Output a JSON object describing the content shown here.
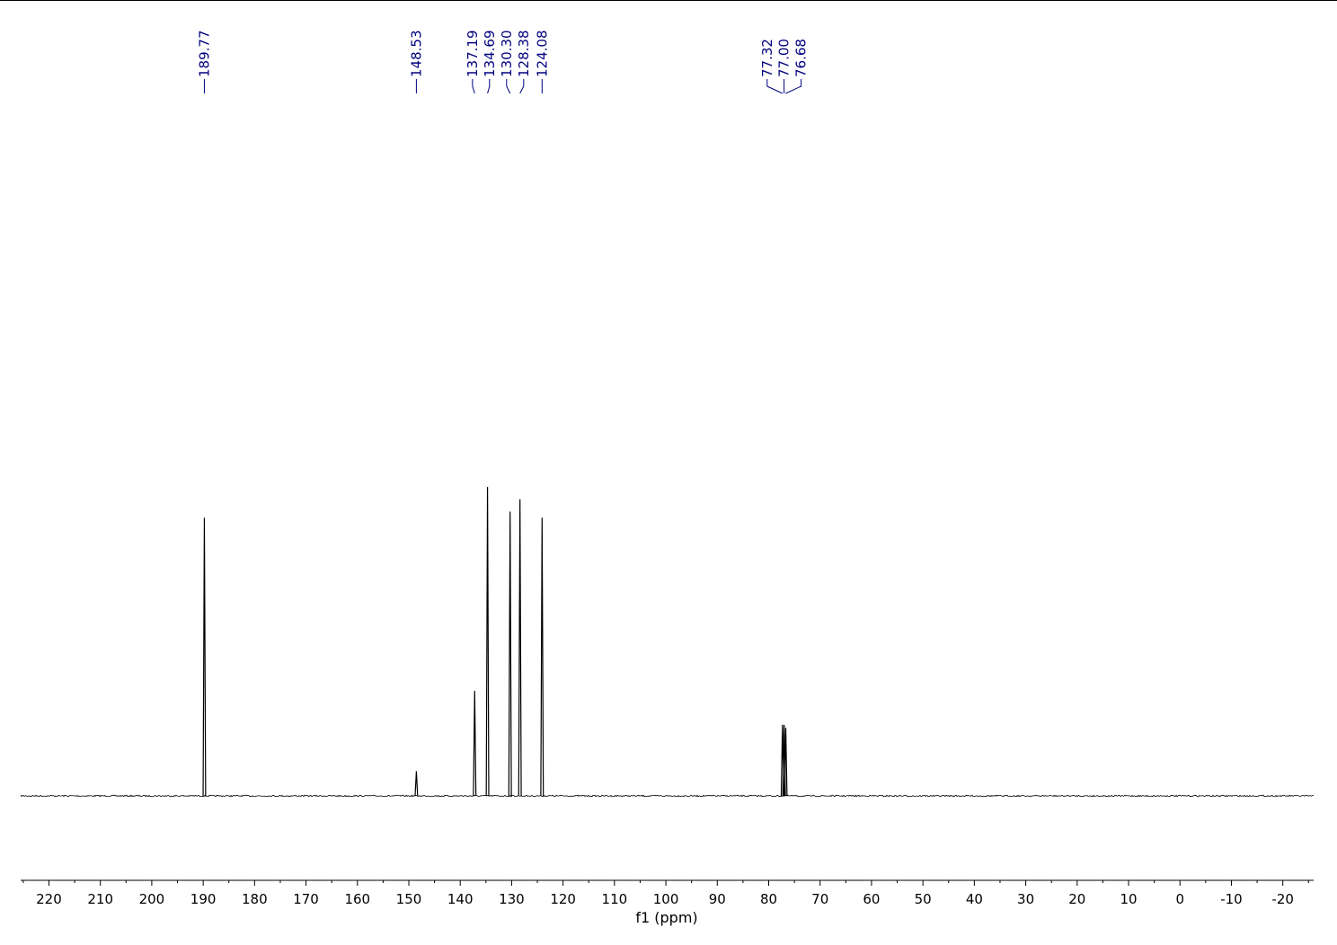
{
  "chart_data": {
    "type": "line",
    "title": "",
    "xlabel": "f1 (ppm)",
    "ylabel": "",
    "x_reversed": true,
    "xlim": [
      225.5,
      -26
    ],
    "x_ticks": [
      220,
      210,
      200,
      190,
      180,
      170,
      160,
      150,
      140,
      130,
      120,
      110,
      100,
      90,
      80,
      70,
      60,
      50,
      40,
      30,
      20,
      10,
      0,
      -10,
      -20
    ],
    "x_tick_labels": [
      "220",
      "210",
      "200",
      "190",
      "180",
      "170",
      "160",
      "150",
      "140",
      "130",
      "120",
      "110",
      "100",
      "90",
      "80",
      "70",
      "60",
      "50",
      "40",
      "30",
      "20",
      "10",
      "0",
      "-10",
      "-20"
    ],
    "ylim": [
      0,
      1.1
    ],
    "grid": false,
    "legend": "none",
    "series": [
      {
        "peaks": [
          {
            "x": 189.77,
            "y": 0.9
          },
          {
            "x": 148.53,
            "y": 0.08
          },
          {
            "x": 137.19,
            "y": 0.34
          },
          {
            "x": 134.69,
            "y": 1.0
          },
          {
            "x": 130.3,
            "y": 0.92
          },
          {
            "x": 128.38,
            "y": 0.96
          },
          {
            "x": 124.08,
            "y": 0.9
          },
          {
            "x": 77.32,
            "y": 0.23
          },
          {
            "x": 77.0,
            "y": 0.23
          },
          {
            "x": 76.68,
            "y": 0.22
          }
        ]
      }
    ],
    "peak_labels": [
      {
        "text": "189.77",
        "x": 189.77
      },
      {
        "text": "148.53",
        "x": 148.53
      },
      {
        "text": "137.19",
        "x": 137.19
      },
      {
        "text": "134.69",
        "x": 134.69
      },
      {
        "text": "130.30",
        "x": 130.3
      },
      {
        "text": "128.38",
        "x": 128.38
      },
      {
        "text": "124.08",
        "x": 124.08
      },
      {
        "text": "77.32",
        "x": 77.32
      },
      {
        "text": "77.00",
        "x": 77.0
      },
      {
        "text": "76.68",
        "x": 76.68
      }
    ],
    "colors": {
      "trace": "#000000",
      "peak_label": "#00007f",
      "axis": "#000000"
    }
  }
}
